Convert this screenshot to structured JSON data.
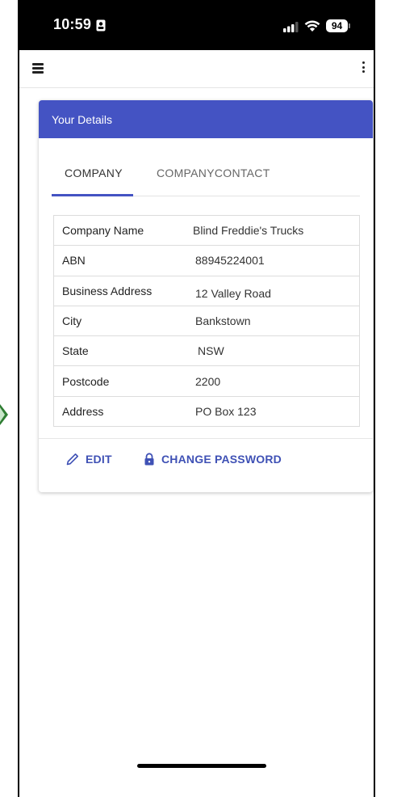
{
  "status_bar": {
    "time": "10:59",
    "battery_percent": "94"
  },
  "app_bar": {
    "menu_icon": "hamburger-icon",
    "more_icon": "more-vert-icon"
  },
  "card": {
    "title": "Your Details",
    "tabs": [
      {
        "label": "COMPANY",
        "active": true
      },
      {
        "label": "COMPANYCONTACT",
        "active": false
      }
    ],
    "rows": [
      {
        "label": "Company Name",
        "value": "Blind Freddie's Trucks"
      },
      {
        "label": "ABN",
        "value": "88945224001"
      },
      {
        "label": "Business Address",
        "value": "12 Valley Road"
      },
      {
        "label": "City",
        "value": "Bankstown"
      },
      {
        "label": "State",
        "value": "NSW"
      },
      {
        "label": "Postcode",
        "value": "2200"
      },
      {
        "label": "Address",
        "value": "PO Box 123"
      }
    ],
    "actions": {
      "edit_label": "EDIT",
      "change_password_label": "CHANGE PASSWORD"
    }
  },
  "colors": {
    "primary": "#4453c3",
    "action_text": "#3f51b5"
  }
}
